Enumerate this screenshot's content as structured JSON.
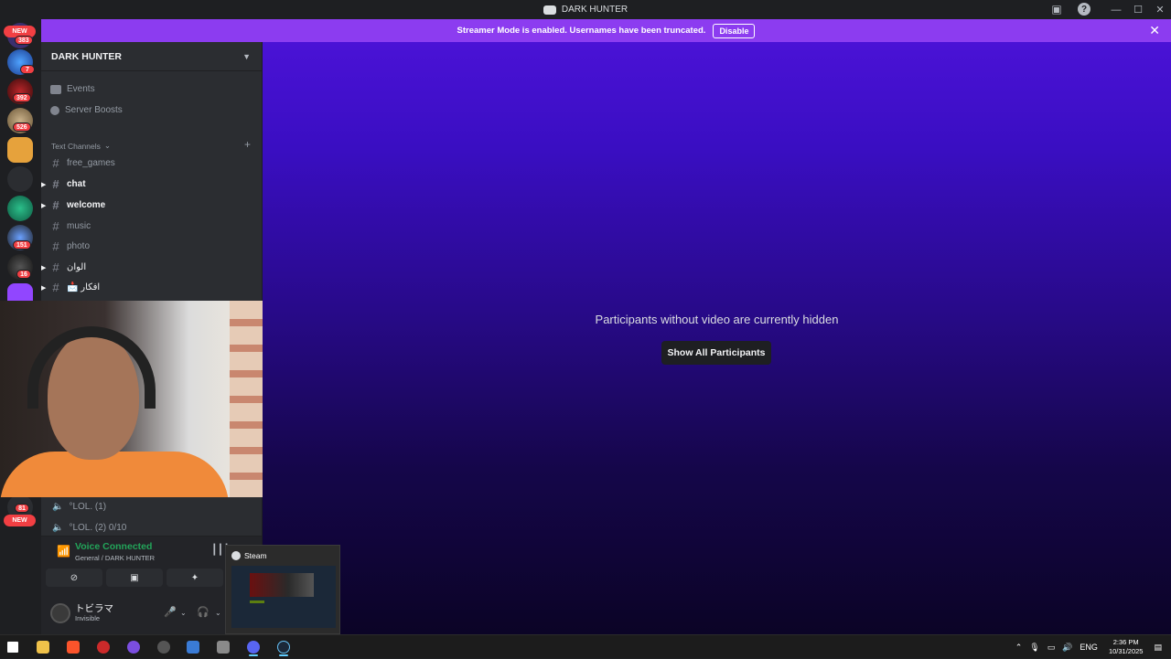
{
  "window": {
    "title": "DARK HUNTER"
  },
  "banner": {
    "message": "Streamer Mode is enabled. Usernames have been truncated.",
    "disable_label": "Disable"
  },
  "guilds": {
    "top_new_label": "NEW",
    "bottom_new_label": "NEW",
    "badges": [
      "383",
      "7",
      "392",
      "526",
      "151",
      "16",
      "81"
    ]
  },
  "server": {
    "name": "DARK HUNTER"
  },
  "nav": {
    "events": "Events",
    "boosts": "Server Boosts"
  },
  "category": {
    "label": "Text Channels"
  },
  "channels": [
    {
      "name": "free_games"
    },
    {
      "name": "chat"
    },
    {
      "name": "welcome"
    },
    {
      "name": "music"
    },
    {
      "name": "photo"
    },
    {
      "name": "الوان"
    },
    {
      "name": "📩 افكار"
    }
  ],
  "voice_channels": [
    {
      "name": "°LOL. (1)"
    },
    {
      "name": "°LOL. (2) 0/10"
    }
  ],
  "voice": {
    "status": "Voice Connected",
    "location": "General / DARK HUNTER"
  },
  "user": {
    "name": "トビラマ",
    "status": "Invisible"
  },
  "main": {
    "hidden_message": "Participants without video are currently hidden",
    "show_all_label": "Show All Participants"
  },
  "preview": {
    "title": "Steam"
  },
  "tray": {
    "lang": "ENG",
    "time": "2:36 PM",
    "date": "10/31/2025"
  },
  "colors": {
    "banner": "#8c3cf0",
    "voice_green": "#23a55a",
    "mention_red": "#f23f43"
  }
}
